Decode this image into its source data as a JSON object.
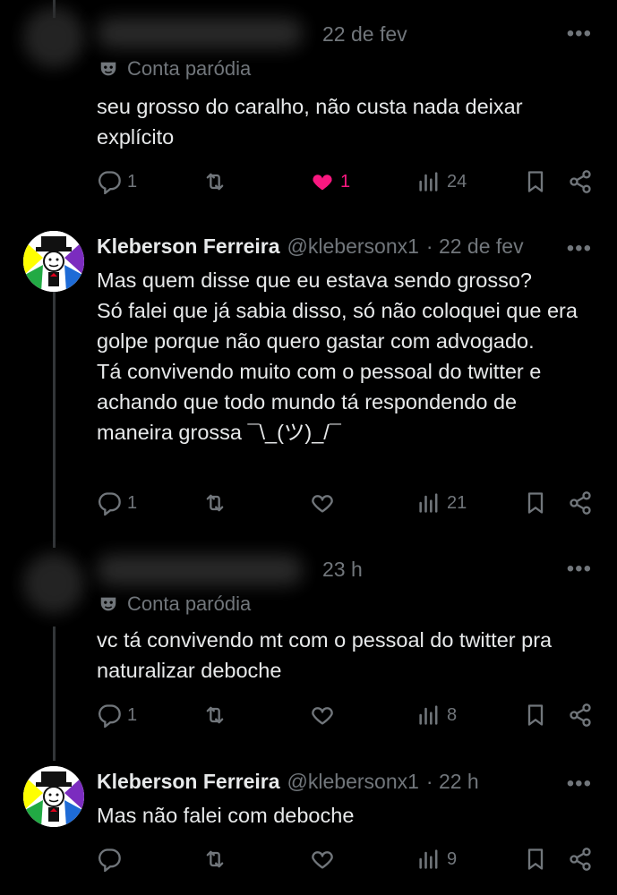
{
  "tweets": [
    {
      "author_visible": false,
      "time": "22 de fev",
      "parody_label": "Conta paródia",
      "text": "seu grosso do caralho, não custa nada deixar explícito",
      "replies": "1",
      "retweets": "",
      "likes": "1",
      "liked": true,
      "views": "24"
    },
    {
      "author_visible": true,
      "name": "Kleberson Ferreira",
      "handle": "@klebersonx1",
      "time": "· 22 de fev",
      "text": "Mas quem disse que eu estava sendo grosso?\nSó falei que já sabia disso, só não coloquei que era golpe porque não quero gastar com advogado.\nTá convivendo muito com o pessoal do twitter e achando que todo mundo tá respondendo de maneira grossa ¯\\_(ツ)_/¯",
      "replies": "1",
      "retweets": "",
      "likes": "",
      "liked": false,
      "views": "21"
    },
    {
      "author_visible": false,
      "time": "23 h",
      "parody_label": "Conta paródia",
      "text": "vc tá convivendo mt com o pessoal do twitter pra naturalizar deboche",
      "replies": "1",
      "retweets": "",
      "likes": "",
      "liked": false,
      "views": "8"
    },
    {
      "author_visible": true,
      "name": "Kleberson Ferreira",
      "handle": "@klebersonx1",
      "time": "· 22 h",
      "text": "Mas não falei com deboche",
      "replies": "",
      "retweets": "",
      "likes": "",
      "liked": false,
      "views": "9"
    }
  ],
  "more_label": "•••",
  "icons": [
    "reply-icon",
    "retweet-icon",
    "like-icon",
    "views-icon",
    "bookmark-icon",
    "share-icon",
    "mask-icon",
    "more-icon"
  ],
  "colors": {
    "background": "#000000",
    "text": "#e7e9ea",
    "muted": "#71767b",
    "like": "#f91880"
  }
}
